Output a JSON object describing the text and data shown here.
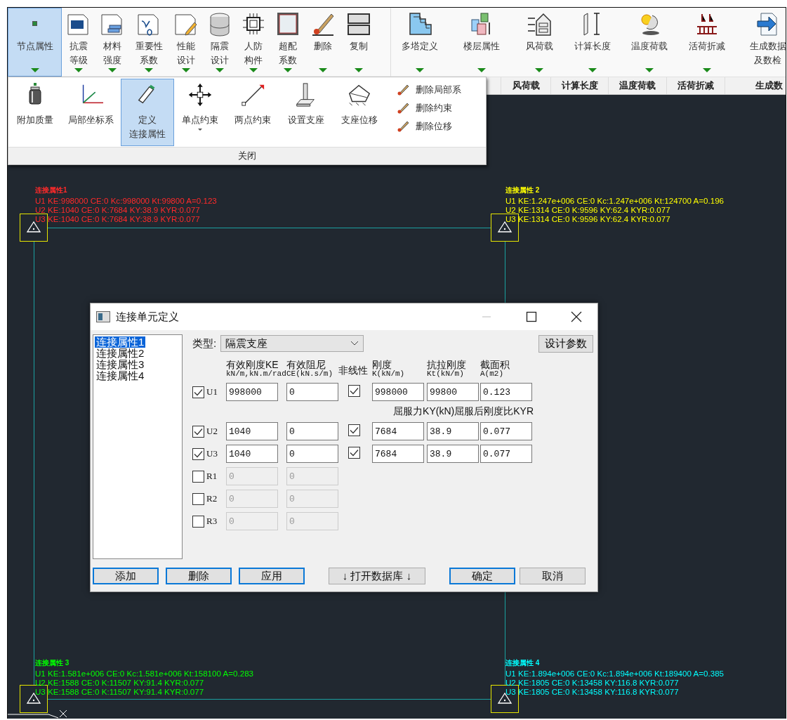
{
  "ribbon": {
    "buttons": [
      {
        "label": "节点属性",
        "selected": true,
        "dropdown": true
      },
      {
        "label": "抗震等级",
        "selected": false,
        "dropdown": true
      },
      {
        "label": "材料强度",
        "selected": false,
        "dropdown": true
      },
      {
        "label": "重要性系数",
        "selected": false,
        "dropdown": true
      },
      {
        "label": "性能设计",
        "selected": false,
        "dropdown": true
      },
      {
        "label": "隔震设计",
        "selected": false,
        "dropdown": true
      },
      {
        "label": "人防构件",
        "selected": false,
        "dropdown": true
      },
      {
        "label": "超配系数",
        "selected": false,
        "dropdown": true
      },
      {
        "label": "删除",
        "selected": false,
        "dropdown": true
      },
      {
        "label": "复制",
        "selected": false,
        "dropdown": true
      },
      {
        "label": "多塔定义",
        "selected": false,
        "dropdown": true
      },
      {
        "label": "楼层属性",
        "selected": false,
        "dropdown": true
      },
      {
        "label": "风荷载",
        "selected": false,
        "dropdown": true
      },
      {
        "label": "计算长度",
        "selected": false,
        "dropdown": true
      },
      {
        "label": "温度荷载",
        "selected": false,
        "dropdown": true
      },
      {
        "label": "活荷折减",
        "selected": false,
        "dropdown": true
      },
      {
        "label": "生成数据及数检",
        "selected": false,
        "dropdown": false
      }
    ],
    "groups": [
      "风荷载",
      "计算长度",
      "温度荷载",
      "活荷折减",
      "生成数"
    ]
  },
  "panel": {
    "tools": [
      {
        "label": "附加质量",
        "selected": false,
        "dropdown": false
      },
      {
        "label": "局部坐标系",
        "selected": false,
        "dropdown": false
      },
      {
        "label": "定义连接属性",
        "selected": true,
        "dropdown": false
      },
      {
        "label": "单点约束",
        "selected": false,
        "dropdown": true
      },
      {
        "label": "两点约束",
        "selected": false,
        "dropdown": false
      },
      {
        "label": "设置支座",
        "selected": false,
        "dropdown": false
      },
      {
        "label": "支座位移",
        "selected": false,
        "dropdown": false
      }
    ],
    "small_tools": [
      "删除局部系",
      "删除约束",
      "删除位移"
    ],
    "footer": "关闭"
  },
  "canvas": {
    "nodes": [
      {
        "title": "连接属性1",
        "color": "#ff2a2a",
        "lines": [
          "U1 KE:998000 CE:0 Kc:998000 Kt:99800 A=0.123",
          "U2 KE:1040 CE:0 K:7684 KY:38.9 KYR:0.077",
          "U3 KE:1040 CE:0 K:7684 KY:38.9 KYR:0.077"
        ]
      },
      {
        "title": "连接属性 2",
        "color": "#ffff00",
        "lines": [
          "U1 KE:1.247e+006 CE:0 Kc:1.247e+006 Kt:124700 A=0.196",
          "U2 KE:1314 CE:0 K:9596 KY:62.4 KYR:0.077",
          "U3 KE:1314 CE:0 K:9596 KY:62.4 KYR:0.077"
        ]
      },
      {
        "title": "连接属性 3",
        "color": "#00ff00",
        "lines": [
          "U1 KE:1.581e+006 CE:0 Kc:1.581e+006 Kt:158100 A=0.283",
          "U2 KE:1588 CE:0 K:11507 KY:91.4 KYR:0.077",
          "U3 KE:1588 CE:0 K:11507 KY:91.4 KYR:0.077"
        ]
      },
      {
        "title": "连接属性 4",
        "color": "#00ffff",
        "lines": [
          "U1 KE:1.894e+006 CE:0 Kc:1.894e+006 Kt:189400 A=0.385",
          "U2 KE:1805 CE:0 K:13458 KY:116.8 KYR:0.077",
          "U3 KE:1805 CE:0 K:13458 KY:116.8 KYR:0.077"
        ]
      }
    ]
  },
  "dialog": {
    "title": "连接单元定义",
    "list": [
      {
        "label": "连接属性1",
        "selected": true
      },
      {
        "label": "连接属性2",
        "selected": false
      },
      {
        "label": "连接属性3",
        "selected": false
      },
      {
        "label": "连接属性4",
        "selected": false
      }
    ],
    "type_label": "类型:",
    "type_value": "隔震支座",
    "design_button": "设计参数",
    "columns": [
      {
        "title": "有效刚度KE",
        "unit": "kN/m,kN.m/rad"
      },
      {
        "title": "有效阻尼",
        "unit": "CE(kN.s/m)"
      },
      {
        "title": "非线性"
      },
      {
        "title": "刚度",
        "unit": "K(kN/m)"
      },
      {
        "title": "抗拉刚度",
        "unit": "Kt(kN/m)"
      },
      {
        "title": "截面积",
        "unit": "A(m2)"
      }
    ],
    "yield_note": "屈服力KY(kN)屈服后刚度比KYR",
    "rows": [
      {
        "axis": "U1",
        "checked": true,
        "disabled": false,
        "ke": "998000",
        "ce": "0",
        "nonlinear": true,
        "k": "998000",
        "kt": "99800",
        "a": "0.123"
      },
      {
        "axis": "U2",
        "checked": true,
        "disabled": false,
        "ke": "1040",
        "ce": "0",
        "nonlinear": true,
        "k": "7684",
        "kt": "38.9",
        "a": "0.077"
      },
      {
        "axis": "U3",
        "checked": true,
        "disabled": false,
        "ke": "1040",
        "ce": "0",
        "nonlinear": true,
        "k": "7684",
        "kt": "38.9",
        "a": "0.077"
      },
      {
        "axis": "R1",
        "checked": false,
        "disabled": true,
        "ke": "0",
        "ce": "0"
      },
      {
        "axis": "R2",
        "checked": false,
        "disabled": true,
        "ke": "0",
        "ce": "0"
      },
      {
        "axis": "R3",
        "checked": false,
        "disabled": true,
        "ke": "0",
        "ce": "0"
      }
    ],
    "buttons": [
      {
        "label": "添加",
        "kind": "blue"
      },
      {
        "label": "删除",
        "kind": "blue"
      },
      {
        "label": "应用",
        "kind": "blue"
      },
      {
        "label": "↓ 打开数据库 ↓",
        "kind": "plain"
      },
      {
        "label": "确定",
        "kind": "blue"
      },
      {
        "label": "取消",
        "kind": "plain"
      }
    ]
  }
}
